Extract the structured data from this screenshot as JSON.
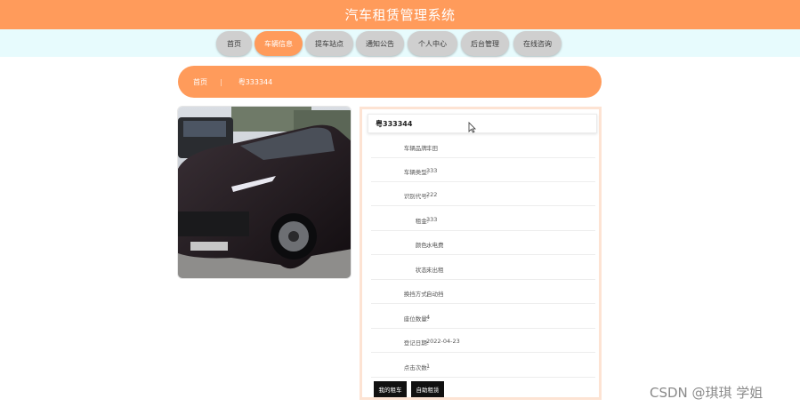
{
  "app": {
    "title": "汽车租赁管理系统"
  },
  "nav": {
    "items": [
      {
        "label": "首页"
      },
      {
        "label": "车辆信息"
      },
      {
        "label": "提车站点"
      },
      {
        "label": "通知公告"
      },
      {
        "label": "个人中心"
      },
      {
        "label": "后台管理"
      },
      {
        "label": "在线咨询"
      }
    ],
    "active_label": "车辆信息"
  },
  "breadcrumb": {
    "home": "首页",
    "current": "粤333344"
  },
  "vehicle": {
    "title": "粤333344",
    "fields": [
      {
        "label": "车辆品牌:",
        "value": "丰田"
      },
      {
        "label": "车辆类型:",
        "value": "333"
      },
      {
        "label": "识别代号:",
        "value": "222"
      },
      {
        "label": "租金:",
        "value": "333"
      },
      {
        "label": "颜色:",
        "value": "水电费"
      },
      {
        "label": "状态:",
        "value": "未出租"
      },
      {
        "label": "换挡方式:",
        "value": "自动挡"
      },
      {
        "label": "座位数量:",
        "value": "4"
      },
      {
        "label": "登记日期:",
        "value": "2022-04-23"
      },
      {
        "label": "点击次数:",
        "value": "1"
      }
    ],
    "actions": {
      "rent_label": "我的租车",
      "self_rent_label": "自助租赁"
    }
  },
  "watermark": "CSDN @琪琪 学姐",
  "colors": {
    "accent": "#ff9b5b",
    "nav_band": "#e7fbfd",
    "nav_pill": "#cfcfcf",
    "card_border": "#fde3d3"
  }
}
